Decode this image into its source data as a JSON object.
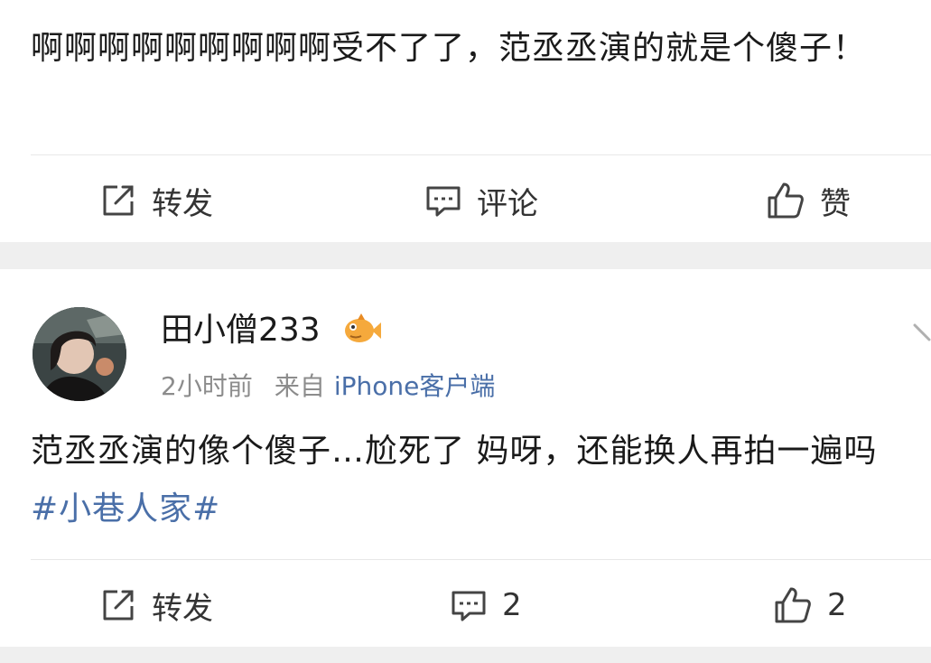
{
  "post1": {
    "text": "啊啊啊啊啊啊啊啊啊受不了了，范丞丞演的就是个傻子！",
    "actions": {
      "repost_label": "转发",
      "comment_label": "评论",
      "like_label": "赞"
    }
  },
  "post2": {
    "username": "田小僧233",
    "time": "2小时前",
    "source_prefix": "来自",
    "source_client": "iPhone客户端",
    "text_main": "范丞丞演的像个傻子…尬死了 妈呀，还能换人再拍一遍吗",
    "topic": "#小巷人家#",
    "actions": {
      "repost_label": "转发",
      "comment_count": "2",
      "like_count": "2"
    }
  },
  "icons": {
    "repost": "repost-icon",
    "comment": "comment-icon",
    "like": "thumbs-up-icon",
    "badge": "fish-badge-icon",
    "chevron": "chevron-down-icon"
  },
  "colors": {
    "link": "#4a6fa8",
    "meta": "#8c8c8c",
    "text": "#1a1a1a",
    "background": "#efefef",
    "badge": "#f0a23a"
  }
}
